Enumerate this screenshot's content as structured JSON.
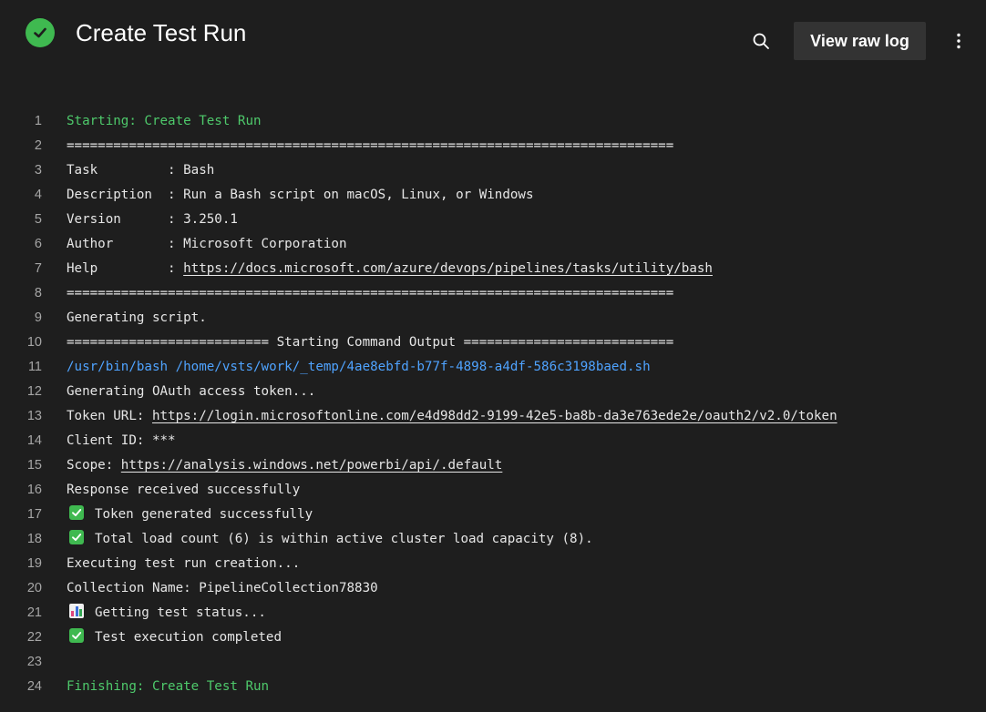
{
  "header": {
    "title": "Create Test Run",
    "raw_log_label": "View raw log",
    "status": "success",
    "accent_color": "#3fb950"
  },
  "log": {
    "lines": [
      {
        "n": "1",
        "text": "Starting: Create Test Run"
      },
      {
        "n": "2",
        "text": "=============================================================================="
      },
      {
        "n": "3",
        "text": "Task         : Bash"
      },
      {
        "n": "4",
        "text": "Description  : Run a Bash script on macOS, Linux, or Windows"
      },
      {
        "n": "5",
        "text": "Version      : 3.250.1"
      },
      {
        "n": "6",
        "text": "Author       : Microsoft Corporation"
      },
      {
        "n": "7",
        "prefix": "Help         : ",
        "link": "https://docs.microsoft.com/azure/devops/pipelines/tasks/utility/bash"
      },
      {
        "n": "8",
        "text": "=============================================================================="
      },
      {
        "n": "9",
        "text": "Generating script."
      },
      {
        "n": "10",
        "text": "========================== Starting Command Output ==========================="
      },
      {
        "n": "11",
        "text": "/usr/bin/bash /home/vsts/work/_temp/4ae8ebfd-b77f-4898-a4df-586c3198baed.sh"
      },
      {
        "n": "12",
        "text": "Generating OAuth access token..."
      },
      {
        "n": "13",
        "prefix": "Token URL: ",
        "link": "https://login.microsoftonline.com/e4d98dd2-9199-42e5-ba8b-da3e763ede2e/oauth2/v2.0/token"
      },
      {
        "n": "14",
        "text": "Client ID: ***"
      },
      {
        "n": "15",
        "prefix": "Scope: ",
        "link": "https://analysis.windows.net/powerbi/api/.default"
      },
      {
        "n": "16",
        "text": "Response received successfully"
      },
      {
        "n": "17",
        "icon": "check-mark-icon",
        "text": "Token generated successfully"
      },
      {
        "n": "18",
        "icon": "check-mark-icon",
        "text": "Total load count (6) is within active cluster load capacity (8)."
      },
      {
        "n": "19",
        "text": "Executing test run creation..."
      },
      {
        "n": "20",
        "text": "Collection Name: PipelineCollection78830"
      },
      {
        "n": "21",
        "icon": "bar-chart-icon",
        "text": "Getting test status..."
      },
      {
        "n": "22",
        "icon": "check-mark-icon",
        "text": "Test execution completed"
      },
      {
        "n": "23",
        "text": ""
      },
      {
        "n": "24",
        "text": "Finishing: Create Test Run"
      }
    ]
  }
}
